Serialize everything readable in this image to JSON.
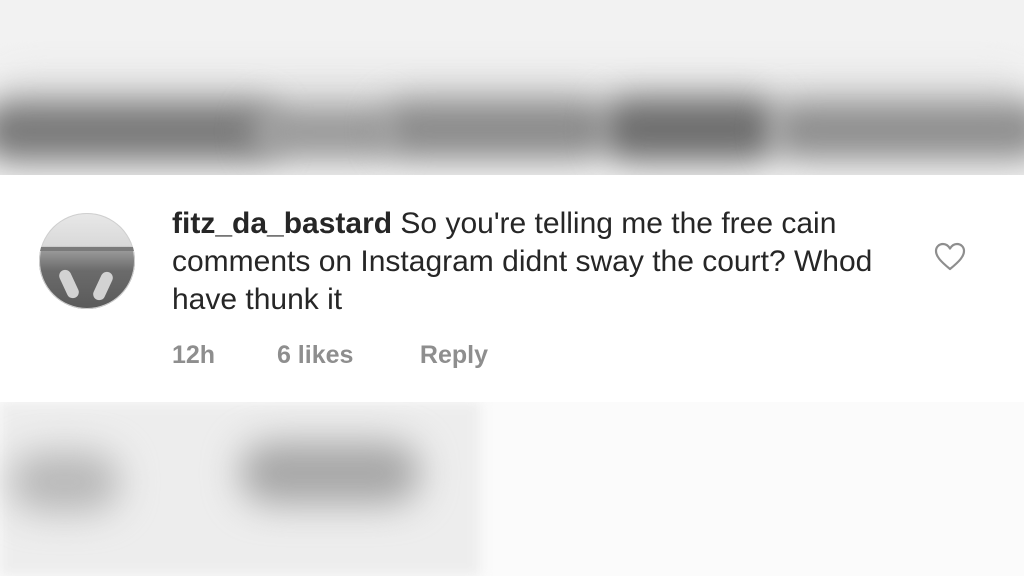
{
  "comment": {
    "username": "fitz_da_bastard",
    "text": "So you're telling me the free cain comments on Instagram didnt sway the court? Whod have thunk it",
    "time": "12h",
    "likes": "6 likes",
    "reply_label": "Reply",
    "like_icon": "heart-outline-icon",
    "avatar": "user-avatar"
  },
  "colors": {
    "text": "#262626",
    "meta": "#8e8e8e",
    "background": "#ffffff"
  }
}
